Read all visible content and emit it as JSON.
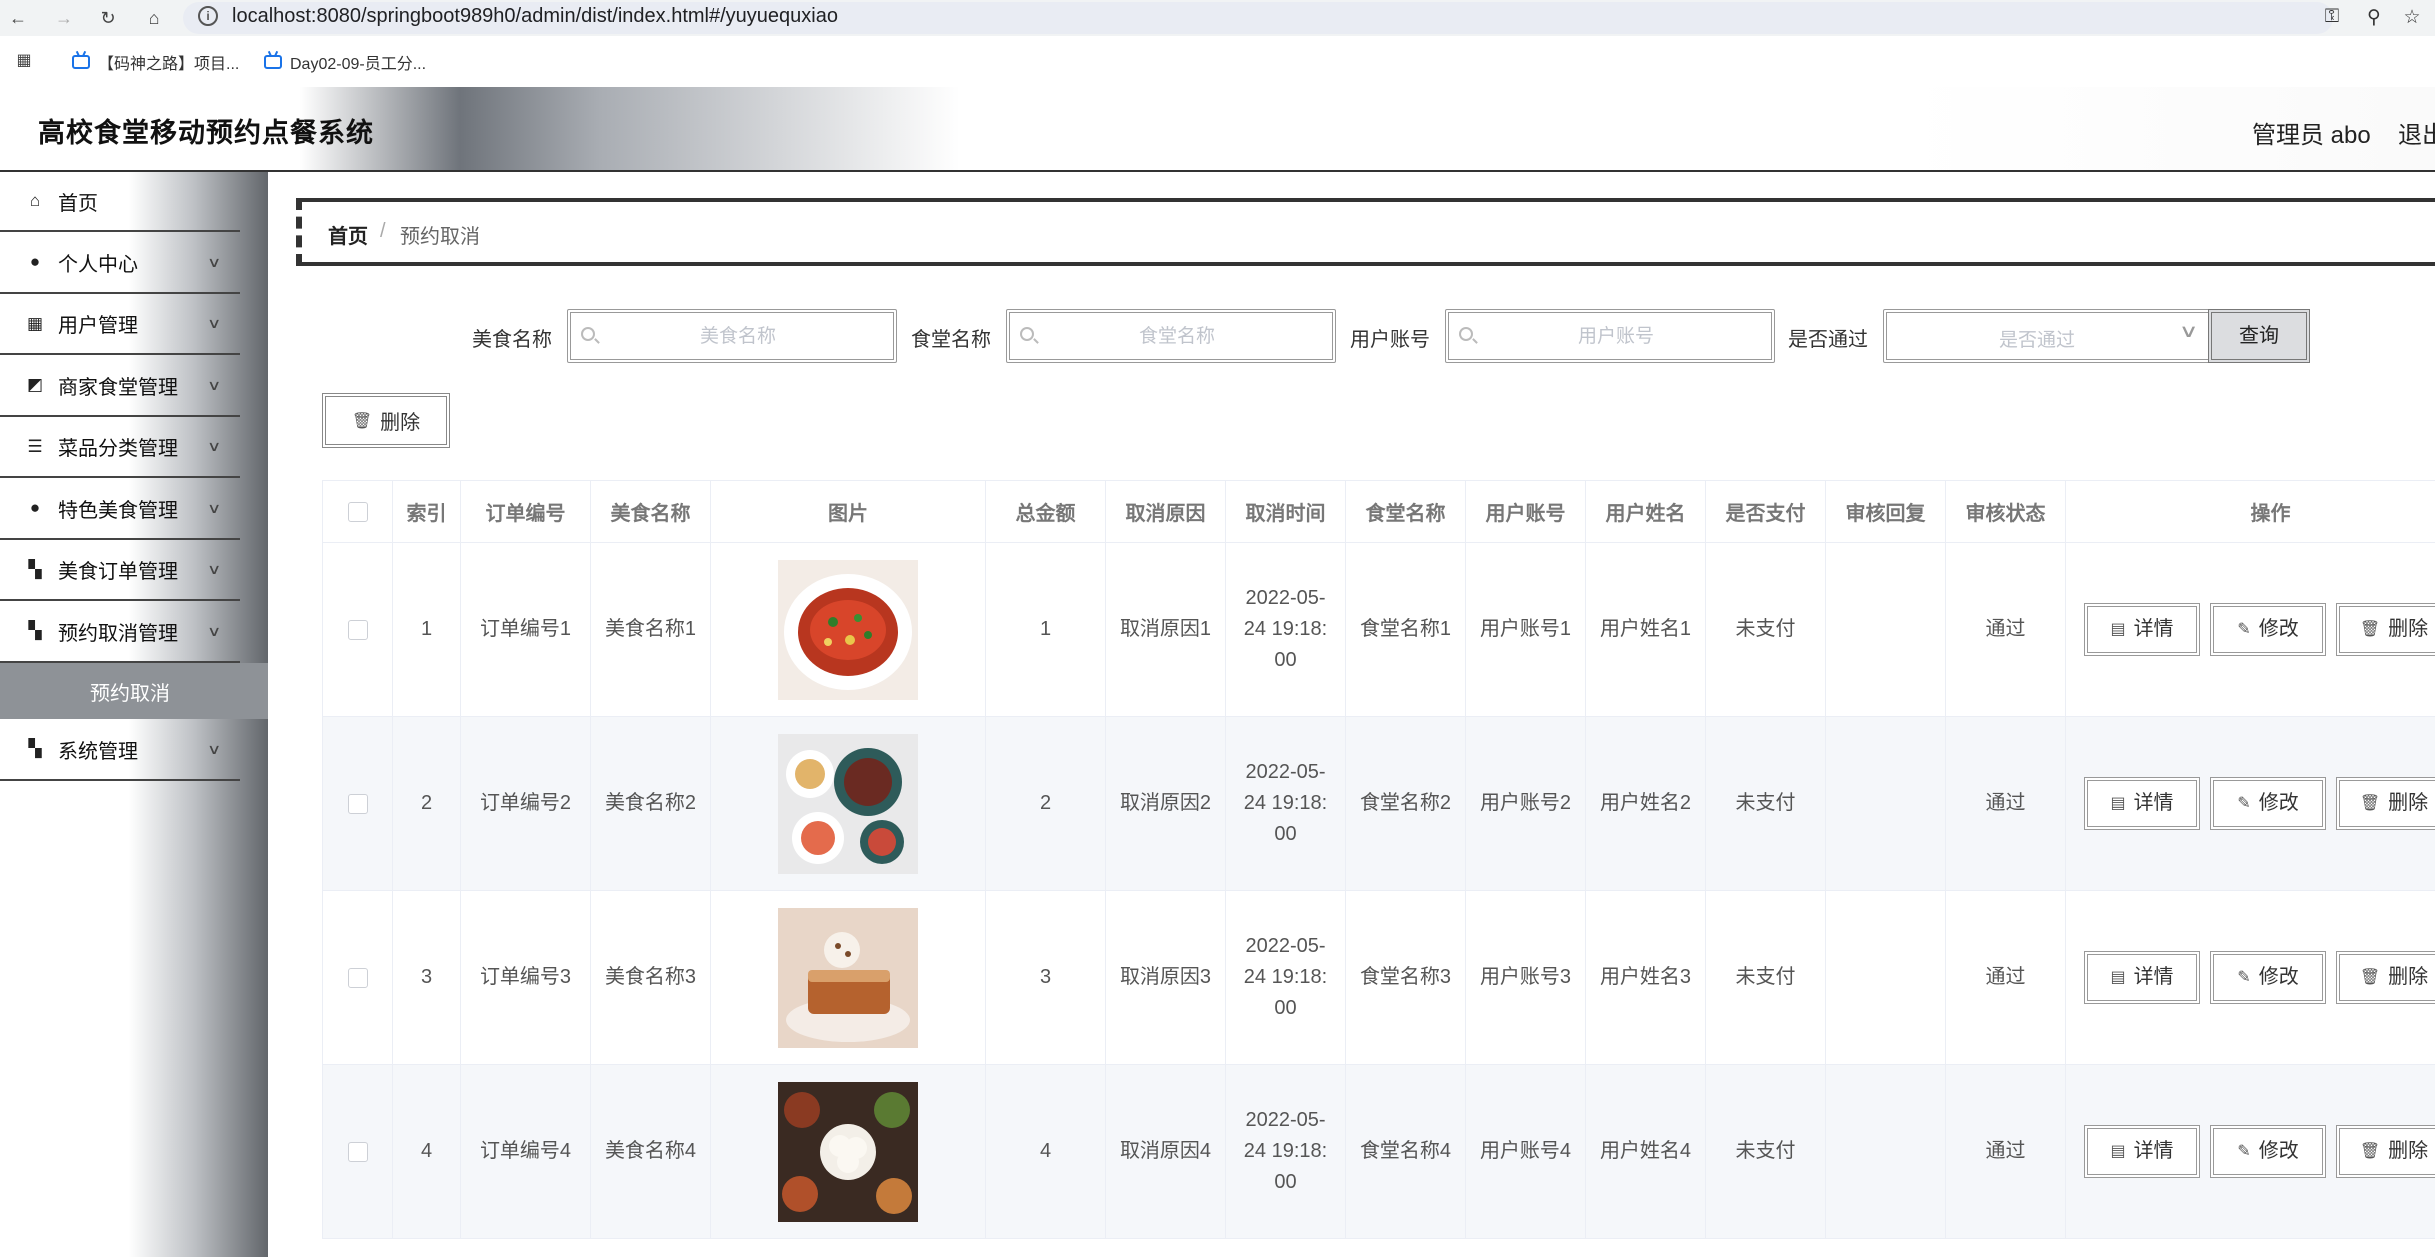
{
  "browser": {
    "url": "localhost:8080/springboot989h0/admin/dist/index.html#/yuyuequxiao",
    "bookmarks": [
      "【码神之路】项目...",
      "Day02-09-员工分..."
    ]
  },
  "header": {
    "title": "高校食堂移动预约点餐系统",
    "user": "管理员 abo",
    "logout": "退出"
  },
  "sidebar": {
    "items": [
      {
        "label": "首页",
        "icon": "home-icon"
      },
      {
        "label": "个人中心",
        "icon": "user-icon"
      },
      {
        "label": "用户管理",
        "icon": "grid-icon"
      },
      {
        "label": "商家食堂管理",
        "icon": "chart-icon"
      },
      {
        "label": "菜品分类管理",
        "icon": "list-icon"
      },
      {
        "label": "特色美食管理",
        "icon": "bulb-icon"
      },
      {
        "label": "美食订单管理",
        "icon": "apps-icon"
      },
      {
        "label": "预约取消管理",
        "icon": "apps-icon"
      },
      {
        "label": "系统管理",
        "icon": "apps-icon"
      }
    ],
    "active_sub": "预约取消"
  },
  "breadcrumb": {
    "home": "首页",
    "sep": "/",
    "current": "预约取消"
  },
  "filters": {
    "food_label": "美食名称",
    "food_placeholder": "美食名称",
    "canteen_label": "食堂名称",
    "canteen_placeholder": "食堂名称",
    "account_label": "用户账号",
    "account_placeholder": "用户账号",
    "passed_label": "是否通过",
    "passed_placeholder": "是否通过",
    "query": "查询"
  },
  "actions": {
    "batch_delete": "删除"
  },
  "table": {
    "headers": [
      "索引",
      "订单编号",
      "美食名称",
      "图片",
      "总金额",
      "取消原因",
      "取消时间",
      "食堂名称",
      "用户账号",
      "用户姓名",
      "是否支付",
      "审核回复",
      "审核状态",
      "操作"
    ],
    "ops": {
      "detail": "详情",
      "edit": "修改",
      "delete": "删除"
    },
    "rows": [
      {
        "idx": "1",
        "order": "订单编号1",
        "food": "美食名称1",
        "total": "1",
        "reason": "取消原因1",
        "t1": "2022-05-",
        "t2": "24 19:18:",
        "t3": "00",
        "canteen": "食堂名称1",
        "account": "用户账号1",
        "name": "用户姓名1",
        "paid": "未支付",
        "reply": "",
        "status": "通过"
      },
      {
        "idx": "2",
        "order": "订单编号2",
        "food": "美食名称2",
        "total": "2",
        "reason": "取消原因2",
        "t1": "2022-05-",
        "t2": "24 19:18:",
        "t3": "00",
        "canteen": "食堂名称2",
        "account": "用户账号2",
        "name": "用户姓名2",
        "paid": "未支付",
        "reply": "",
        "status": "通过"
      },
      {
        "idx": "3",
        "order": "订单编号3",
        "food": "美食名称3",
        "total": "3",
        "reason": "取消原因3",
        "t1": "2022-05-",
        "t2": "24 19:18:",
        "t3": "00",
        "canteen": "食堂名称3",
        "account": "用户账号3",
        "name": "用户姓名3",
        "paid": "未支付",
        "reply": "",
        "status": "通过"
      },
      {
        "idx": "4",
        "order": "订单编号4",
        "food": "美食名称4",
        "total": "4",
        "reason": "取消原因4",
        "t1": "2022-05-",
        "t2": "24 19:18:",
        "t3": "00",
        "canteen": "食堂名称4",
        "account": "用户账号4",
        "name": "用户姓名4",
        "paid": "未支付",
        "reply": "",
        "status": "通过"
      }
    ]
  }
}
